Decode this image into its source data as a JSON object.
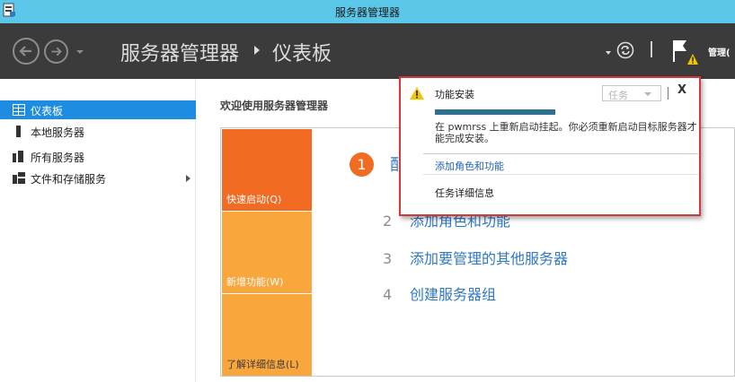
{
  "window": {
    "title": "服务器管理器"
  },
  "header": {
    "app_name": "服务器管理器",
    "page": "仪表板",
    "manage_label": "管理(",
    "colors": {
      "background": "#3b3b3b",
      "titlebar": "#5bc8ea"
    }
  },
  "sidebar": {
    "items": [
      {
        "label": "仪表板",
        "icon": "dashboard-icon",
        "active": true
      },
      {
        "label": "本地服务器",
        "icon": "local-server-icon"
      },
      {
        "label": "所有服务器",
        "icon": "all-servers-icon"
      },
      {
        "label": "文件和存储服务",
        "icon": "file-storage-icon",
        "has_submenu": true
      }
    ]
  },
  "main": {
    "title": "欢迎使用服务器管理器",
    "tiles": [
      {
        "label": "快速启动(Q)",
        "color": "#f16b23"
      },
      {
        "label": "新增功能(W)",
        "color": "#f9a63c"
      },
      {
        "label": "了解详细信息(L)",
        "color": "#f9a63c"
      }
    ],
    "steps": [
      {
        "num": "1",
        "text": "配"
      },
      {
        "num": "2",
        "text": "添加角色和功能"
      },
      {
        "num": "3",
        "text": "添加要管理的其他服务器"
      },
      {
        "num": "4",
        "text": "创建服务器组"
      }
    ]
  },
  "notification": {
    "title": "功能安装",
    "task_dropdown": "任务",
    "close": "X",
    "progress": 1.0,
    "message": "在 pwmrss 上重新启动挂起。你必须重新启动目标服务器才能完成安装。",
    "link": "添加角色和功能",
    "details": "任务详细信息",
    "border_color": "#d23a3a"
  }
}
